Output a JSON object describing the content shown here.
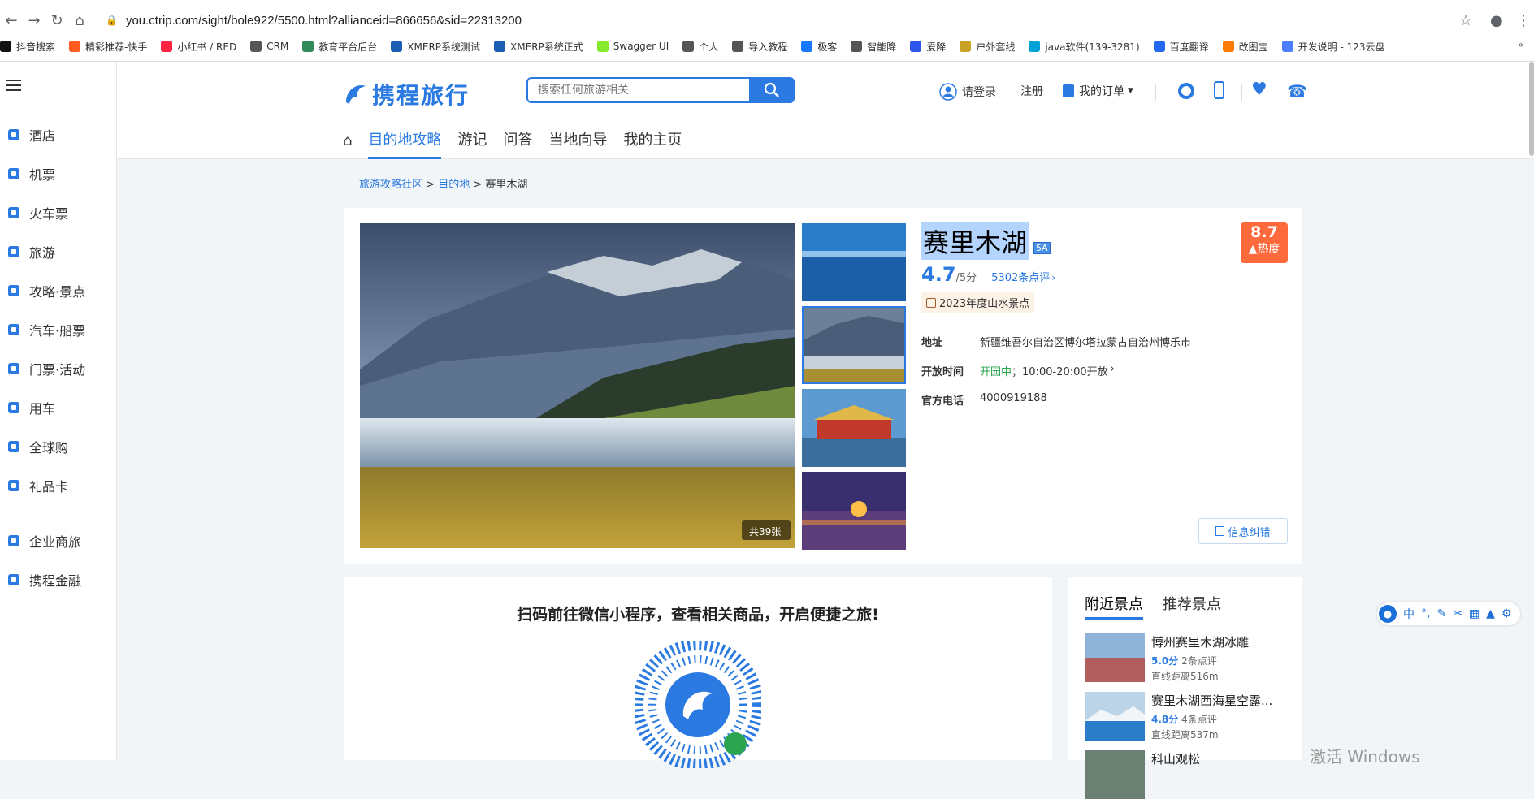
{
  "browser": {
    "url": "you.ctrip.com/sight/bole922/5500.html?allianceid=866656&sid=22313200",
    "bookmarks": [
      {
        "label": "抖音搜索",
        "color": "#111111"
      },
      {
        "label": "精彩推荐-快手",
        "color": "#ff5a1f"
      },
      {
        "label": "小红书 / RED",
        "color": "#ff2442"
      },
      {
        "label": "CRM",
        "color": "#555555"
      },
      {
        "label": "教育平台后台",
        "color": "#2e8b57"
      },
      {
        "label": "XMERP系统测试",
        "color": "#1a5fb4"
      },
      {
        "label": "XMERP系统正式",
        "color": "#1a5fb4"
      },
      {
        "label": "Swagger UI",
        "color": "#85ea2d"
      },
      {
        "label": "个人",
        "color": "#555555"
      },
      {
        "label": "导入教程",
        "color": "#555555"
      },
      {
        "label": "极客",
        "color": "#1677ff"
      },
      {
        "label": "智能降",
        "color": "#555555"
      },
      {
        "label": "爱降",
        "color": "#2f54eb"
      },
      {
        "label": "户外套线",
        "color": "#c9a227"
      },
      {
        "label": "java软件(139-3281)",
        "color": "#00a1d6"
      },
      {
        "label": "百度翻译",
        "color": "#2468f2"
      },
      {
        "label": "改图宝",
        "color": "#ff7a00"
      },
      {
        "label": "开发说明 - 123云盘",
        "color": "#4c7cff"
      }
    ]
  },
  "sidebar": {
    "items": [
      {
        "label": "酒店",
        "icon": "hotel-icon"
      },
      {
        "label": "机票",
        "icon": "plane-icon"
      },
      {
        "label": "火车票",
        "icon": "train-icon"
      },
      {
        "label": "旅游",
        "icon": "travel-icon"
      },
      {
        "label": "攻略·景点",
        "icon": "guide-icon"
      },
      {
        "label": "汽车·船票",
        "icon": "bus-icon"
      },
      {
        "label": "门票·活动",
        "icon": "ticket-icon"
      },
      {
        "label": "用车",
        "icon": "car-icon"
      },
      {
        "label": "全球购",
        "icon": "globe-icon"
      },
      {
        "label": "礼品卡",
        "icon": "gift-card-icon"
      }
    ],
    "bottom_items": [
      {
        "label": "企业商旅",
        "icon": "business-icon"
      },
      {
        "label": "携程金融",
        "icon": "finance-icon"
      }
    ]
  },
  "header": {
    "logo": "携程旅行",
    "search_placeholder": "搜索任何旅游相关",
    "login": "请登录",
    "register": "注册",
    "orders": "我的订单",
    "nav": [
      "目的地攻略",
      "游记",
      "问答",
      "当地向导",
      "我的主页"
    ]
  },
  "breadcrumb": {
    "community": "旅游攻略社区",
    "destination": "目的地",
    "current": "赛里木湖"
  },
  "sight": {
    "title": "赛里木湖",
    "level": "5A",
    "score": "4.7",
    "score_unit": "/5分",
    "reviews": "5302条点评",
    "tag": "2023年度山水景点",
    "heat_value": "8.7",
    "heat_label": "热度",
    "address_label": "地址",
    "address": "新疆维吾尔自治区博尔塔拉蒙古自治州博乐市",
    "hours_label": "开放时间",
    "hours_status": "开园中",
    "hours": "；10:00-20:00开放",
    "phone_label": "官方电话",
    "phone": "4000919188",
    "photo_count": "共39张",
    "correction": "信息纠错"
  },
  "qr": {
    "text": "扫码前往微信小程序，查看相关商品，开启便捷之旅!"
  },
  "nearby": {
    "tabs": [
      "附近景点",
      "推荐景点"
    ],
    "items": [
      {
        "name": "博州赛里木湖冰雕",
        "score": "5.0分",
        "reviews": "2条点评",
        "distance": "直线距离516m"
      },
      {
        "name": "赛里木湖西海星空露...",
        "score": "4.8分",
        "reviews": "4条点评",
        "distance": "直线距离537m"
      },
      {
        "name": "科山观松",
        "score": "",
        "reviews": "",
        "distance": ""
      }
    ]
  },
  "ime": {
    "label": "中"
  },
  "watermark": "激活 Windows",
  "colors": {
    "accent": "#2a7ae2",
    "heat": "#ff6a3d",
    "open": "#2aa44f"
  }
}
